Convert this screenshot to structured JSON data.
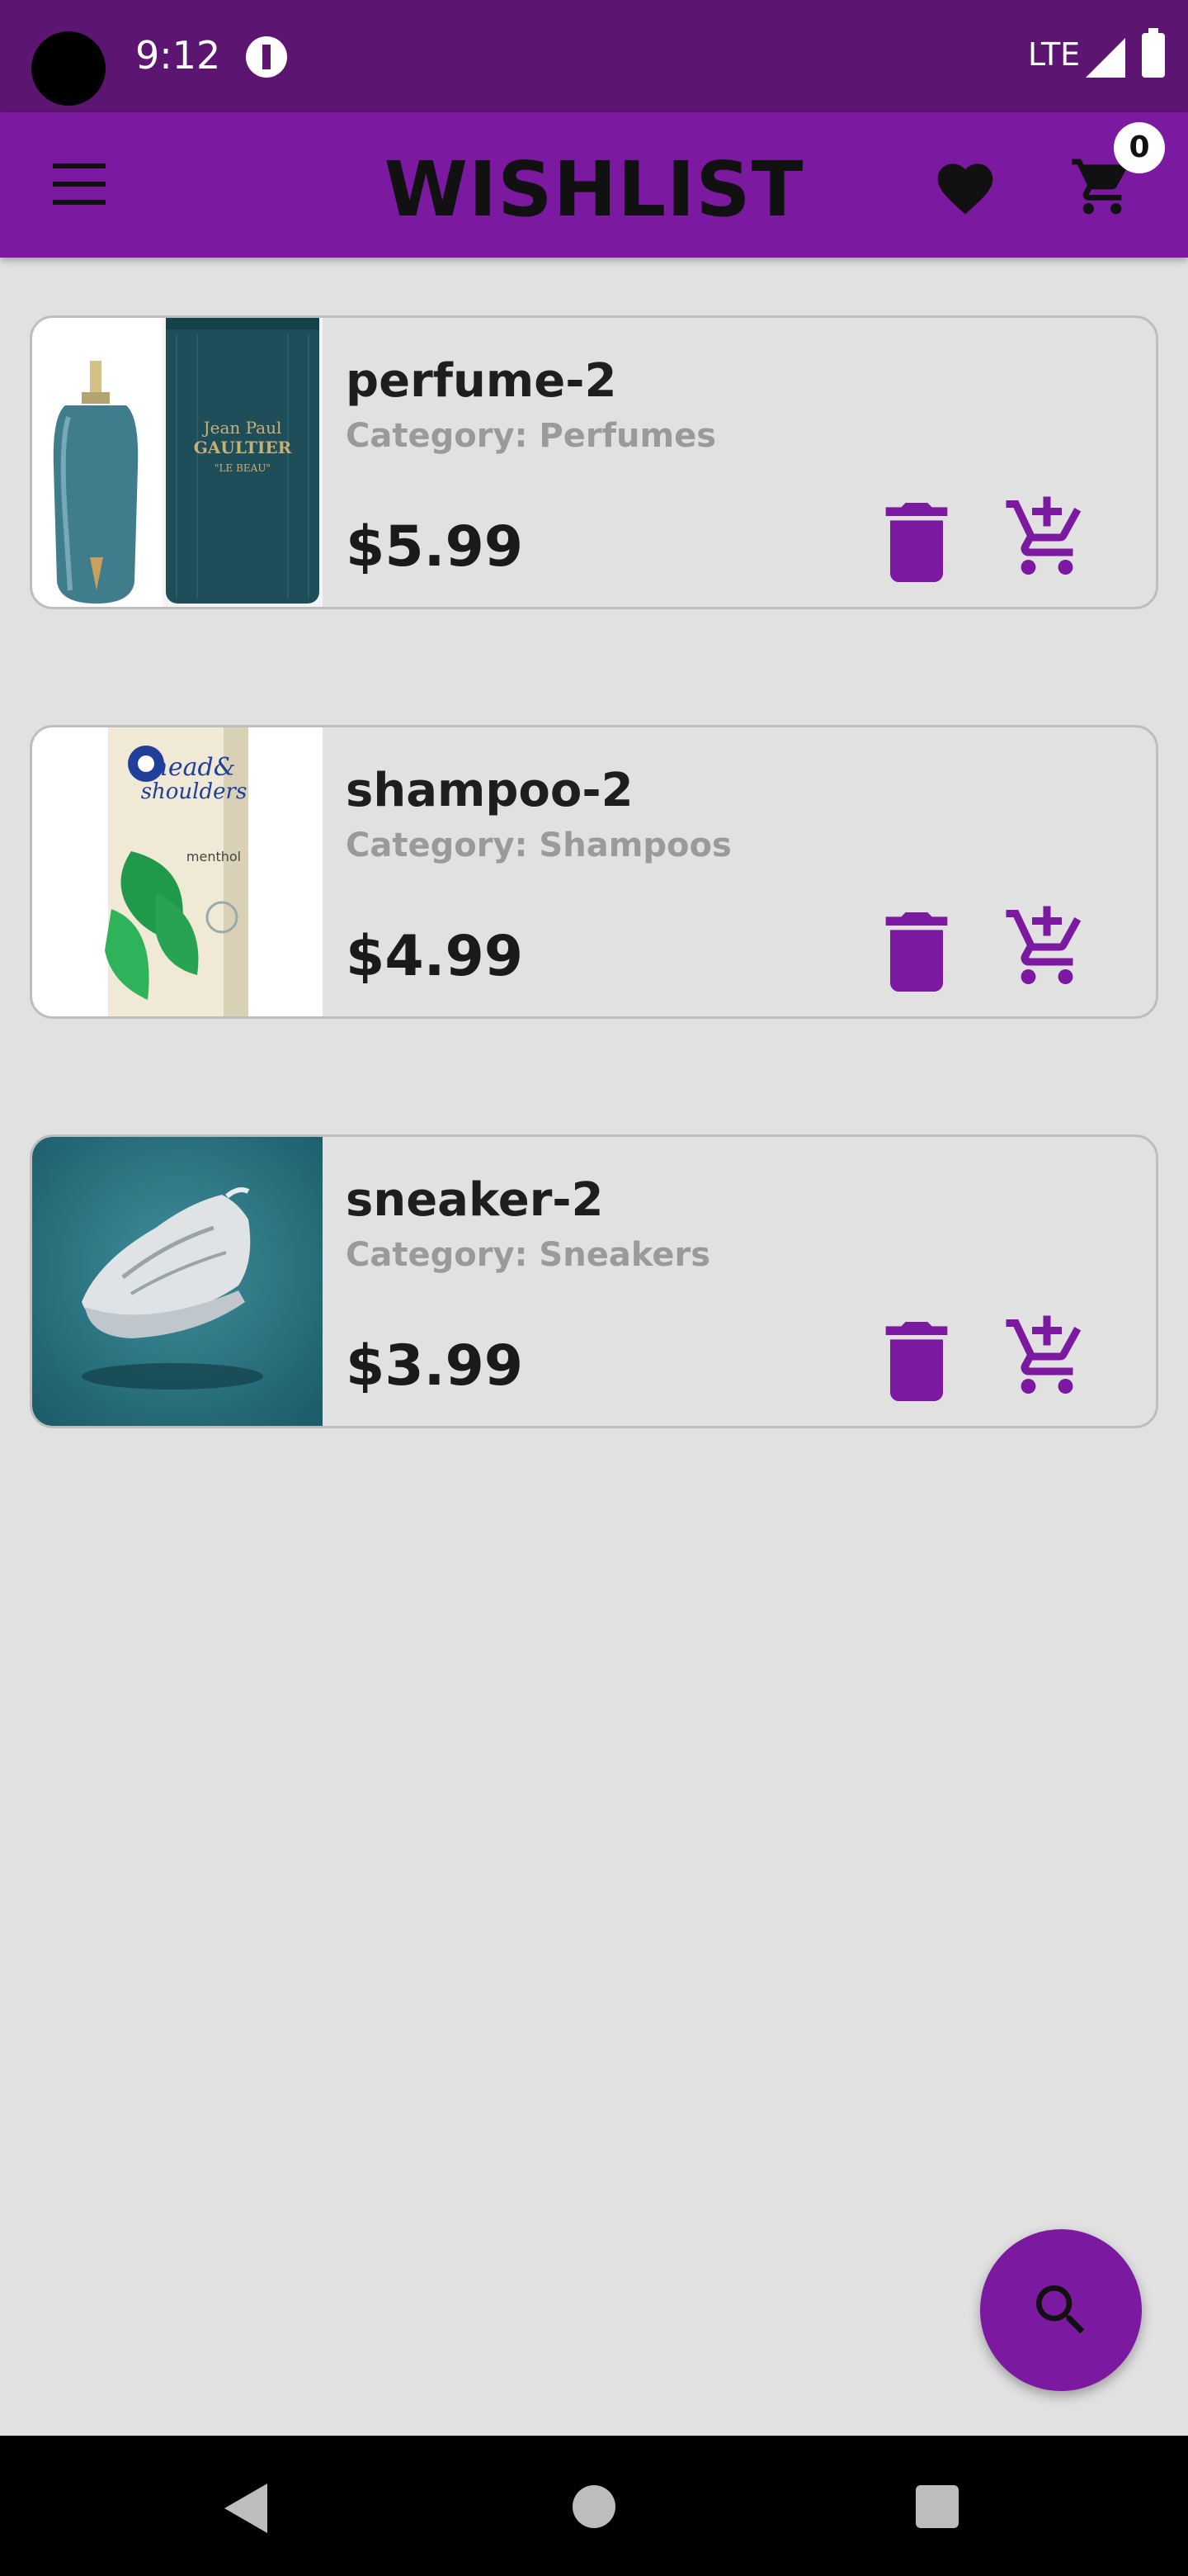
{
  "status_bar": {
    "time": "9:12",
    "network": "LTE"
  },
  "app_bar": {
    "title": "WISHLIST",
    "cart_count": "0"
  },
  "colors": {
    "primary": "#7b1aa0",
    "status_bar": "#5c1570",
    "background": "#e1e1e1",
    "icon": "#7b1aa0"
  },
  "items": [
    {
      "name": "perfume-2",
      "category": "Category: Perfumes",
      "price": "$5.99",
      "image_icon": "perfume-bottle-image"
    },
    {
      "name": "shampoo-2",
      "category": "Category: Shampoos",
      "price": "$4.99",
      "image_icon": "shampoo-bottle-image"
    },
    {
      "name": "sneaker-2",
      "category": "Category: Sneakers",
      "price": "$3.99",
      "image_icon": "sneaker-image"
    }
  ],
  "fab": {
    "icon": "search-icon"
  }
}
